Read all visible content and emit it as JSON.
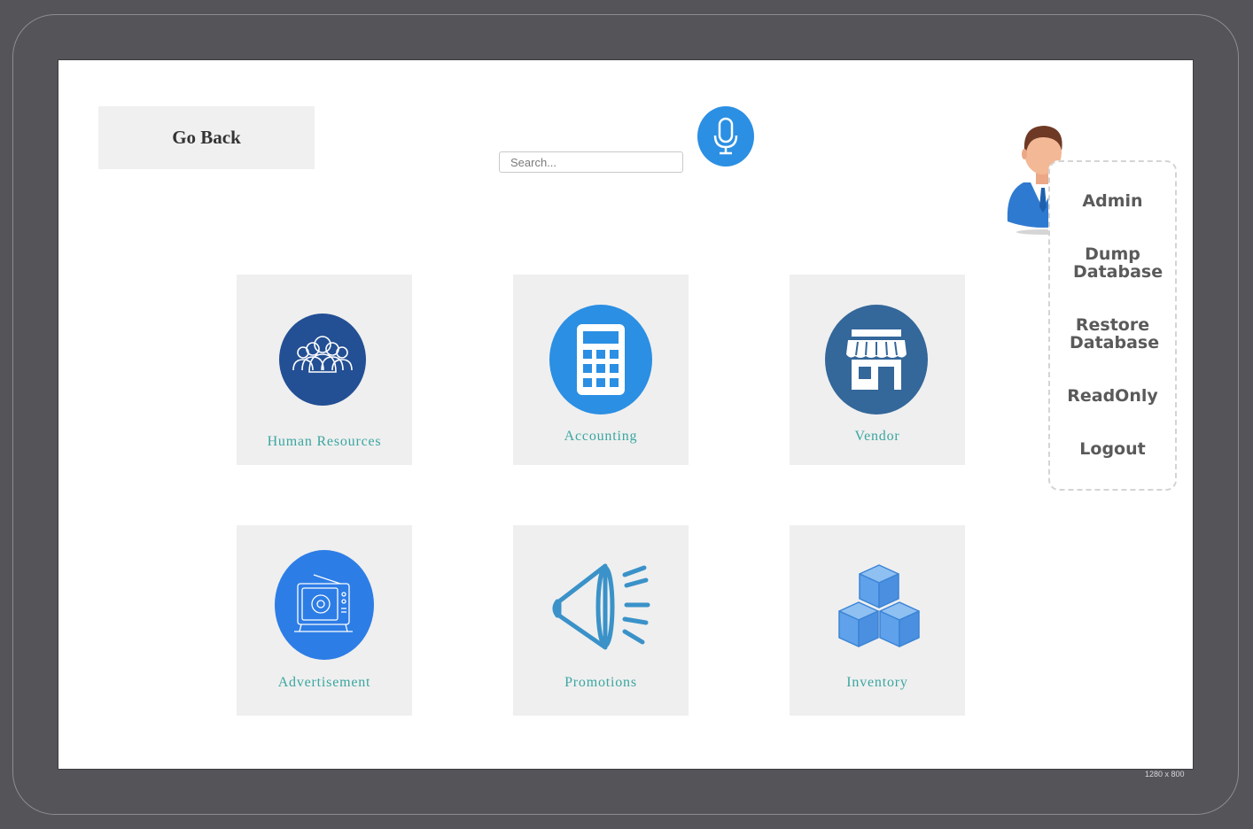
{
  "header": {
    "go_back_label": "Go Back",
    "search_placeholder": "Search...",
    "mic_icon": "microphone-icon",
    "mic_color": "#2b8fe3",
    "avatar_icon": "admin-user-avatar"
  },
  "user_menu": {
    "items": [
      {
        "label": "Admin"
      },
      {
        "label": "Dump Database"
      },
      {
        "label": "Restore Database"
      },
      {
        "label": "ReadOnly"
      },
      {
        "label": "Logout"
      }
    ]
  },
  "modules": [
    {
      "label": "Human Resources",
      "icon": "people-group-icon",
      "color": "#234f94"
    },
    {
      "label": "Accounting",
      "icon": "calculator-icon",
      "color": "#2b8fe3"
    },
    {
      "label": "Vendor",
      "icon": "storefront-icon",
      "color": "#34679a"
    },
    {
      "label": "Advertisement",
      "icon": "television-icon",
      "color": "#2d7de6"
    },
    {
      "label": "Promotions",
      "icon": "megaphone-icon",
      "color": "#3a92c9"
    },
    {
      "label": "Inventory",
      "icon": "boxes-icon",
      "color": "#4b95e0"
    }
  ],
  "label_color": "#3aa6a0",
  "frame_caption": "1280 x 800"
}
